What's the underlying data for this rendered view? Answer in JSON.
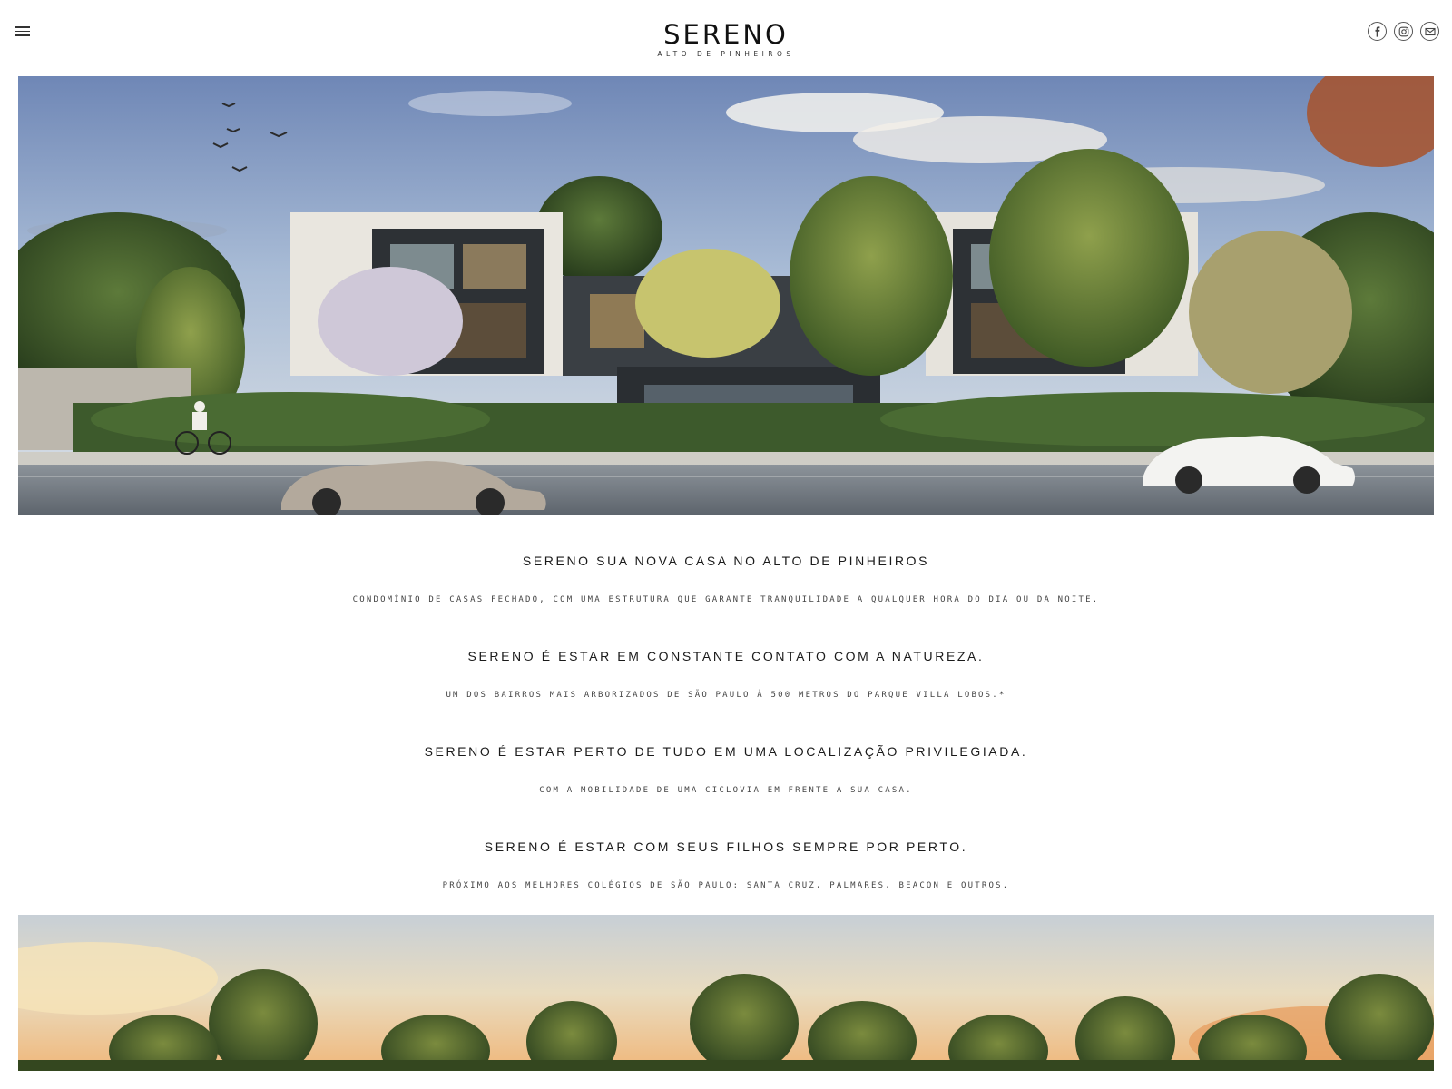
{
  "header": {
    "menu_icon": "hamburger-menu-icon",
    "logo": {
      "name": "SERENO",
      "tagline": "ALTO DE PINHEIROS"
    },
    "social": [
      {
        "icon": "facebook-icon"
      },
      {
        "icon": "instagram-icon"
      },
      {
        "icon": "mail-icon"
      }
    ]
  },
  "hero": {
    "description": "image"
  },
  "sections": [
    {
      "heading": "SERENO SUA NOVA CASA NO ALTO DE PINHEIROS",
      "subtext": "CONDOMÍNIO DE CASAS FECHADO, COM UMA ESTRUTURA QUE GARANTE TRANQUILIDADE A QUALQUER HORA DO DIA OU DA NOITE."
    },
    {
      "heading": "SERENO É ESTAR EM CONSTANTE CONTATO COM A NATUREZA.",
      "subtext": "UM DOS BAIRROS MAIS ARBORIZADOS DE SÃO PAULO À 500 METROS DO PARQUE VILLA LOBOS.*"
    },
    {
      "heading": "SERENO É ESTAR PERTO DE TUDO EM UMA LOCALIZAÇÃO PRIVILEGIADA.",
      "subtext": "COM A MOBILIDADE DE UMA CICLOVIA EM FRENTE A SUA CASA."
    },
    {
      "heading": "SERENO É ESTAR COM SEUS FILHOS SEMPRE POR PERTO.",
      "subtext": "PRÓXIMO AOS MELHORES COLÉGIOS DE SÃO PAULO: SANTA CRUZ, PALMARES, BEACON E OUTROS."
    }
  ]
}
